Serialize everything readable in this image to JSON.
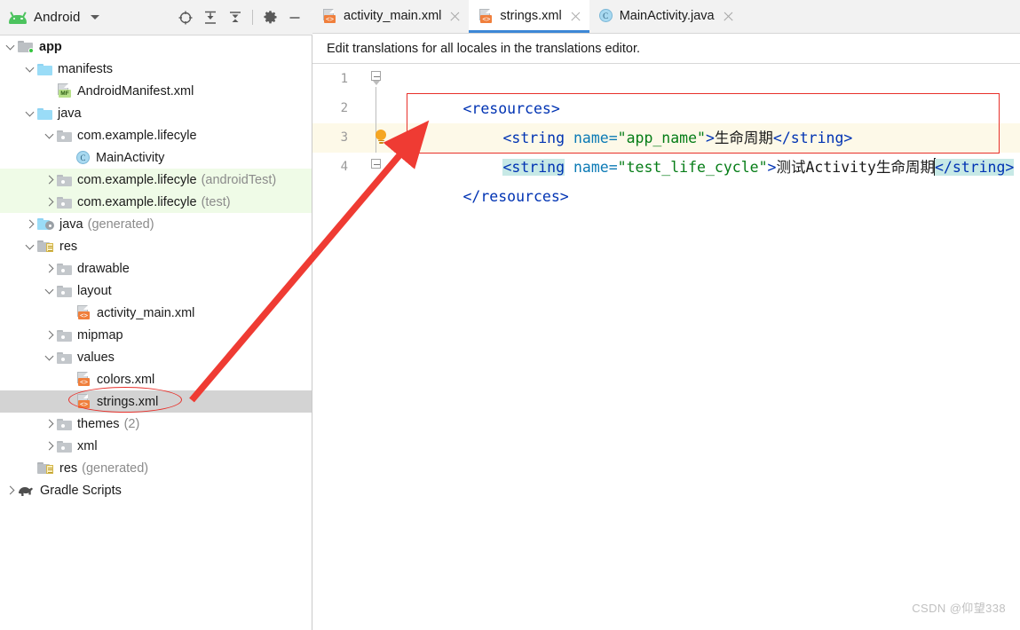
{
  "window": {
    "panel_title": "Android",
    "watermark": "CSDN @仰望338"
  },
  "toolbar": {
    "icons": [
      {
        "name": "locate-target-icon",
        "label": "Select Opened File"
      },
      {
        "name": "expand-all-icon",
        "label": "Expand All"
      },
      {
        "name": "collapse-all-icon",
        "label": "Collapse All"
      },
      {
        "name": "settings-gear-icon",
        "label": "Settings"
      },
      {
        "name": "minimize-icon",
        "label": "Hide"
      }
    ]
  },
  "tree": {
    "items": [
      {
        "label": "app",
        "sub": "",
        "icon": "folder-app-icon",
        "indent": 0,
        "arrow": "expanded",
        "bold": true,
        "state": "normal"
      },
      {
        "label": "manifests",
        "sub": "",
        "icon": "folder-blue-icon",
        "indent": 1,
        "arrow": "expanded",
        "bold": false,
        "state": "normal"
      },
      {
        "label": "AndroidManifest.xml",
        "sub": "",
        "icon": "manifest-file-icon",
        "indent": 2,
        "arrow": "none",
        "bold": false,
        "state": "normal"
      },
      {
        "label": "java",
        "sub": "",
        "icon": "folder-blue-icon",
        "indent": 1,
        "arrow": "expanded",
        "bold": false,
        "state": "normal"
      },
      {
        "label": "com.example.lifecyle",
        "sub": "",
        "icon": "package-icon",
        "indent": 2,
        "arrow": "expanded",
        "bold": false,
        "state": "normal"
      },
      {
        "label": "MainActivity",
        "sub": "",
        "icon": "java-class-icon",
        "indent": 3,
        "arrow": "none",
        "bold": false,
        "state": "normal"
      },
      {
        "label": "com.example.lifecyle",
        "sub": "(androidTest)",
        "icon": "package-icon",
        "indent": 2,
        "arrow": "collapsed",
        "bold": false,
        "state": "green"
      },
      {
        "label": "com.example.lifecyle",
        "sub": "(test)",
        "icon": "package-icon",
        "indent": 2,
        "arrow": "collapsed",
        "bold": false,
        "state": "green"
      },
      {
        "label": "java",
        "sub": "(generated)",
        "icon": "folder-generated-icon",
        "indent": 1,
        "arrow": "collapsed",
        "bold": false,
        "state": "normal"
      },
      {
        "label": "res",
        "sub": "",
        "icon": "folder-res-icon",
        "indent": 1,
        "arrow": "expanded",
        "bold": false,
        "state": "normal"
      },
      {
        "label": "drawable",
        "sub": "",
        "icon": "package-icon",
        "indent": 2,
        "arrow": "collapsed",
        "bold": false,
        "state": "normal"
      },
      {
        "label": "layout",
        "sub": "",
        "icon": "package-icon",
        "indent": 2,
        "arrow": "expanded",
        "bold": false,
        "state": "normal"
      },
      {
        "label": "activity_main.xml",
        "sub": "",
        "icon": "xml-file-icon",
        "indent": 3,
        "arrow": "none",
        "bold": false,
        "state": "normal"
      },
      {
        "label": "mipmap",
        "sub": "",
        "icon": "package-icon",
        "indent": 2,
        "arrow": "collapsed",
        "bold": false,
        "state": "normal"
      },
      {
        "label": "values",
        "sub": "",
        "icon": "package-icon",
        "indent": 2,
        "arrow": "expanded",
        "bold": false,
        "state": "normal"
      },
      {
        "label": "colors.xml",
        "sub": "",
        "icon": "xml-file-icon",
        "indent": 3,
        "arrow": "none",
        "bold": false,
        "state": "normal"
      },
      {
        "label": "strings.xml",
        "sub": "",
        "icon": "xml-file-icon",
        "indent": 3,
        "arrow": "none",
        "bold": false,
        "state": "selected"
      },
      {
        "label": "themes",
        "sub": "(2)",
        "icon": "package-icon",
        "indent": 2,
        "arrow": "collapsed",
        "bold": false,
        "state": "normal"
      },
      {
        "label": "xml",
        "sub": "",
        "icon": "package-icon",
        "indent": 2,
        "arrow": "collapsed",
        "bold": false,
        "state": "normal"
      },
      {
        "label": "res",
        "sub": "(generated)",
        "icon": "folder-res-icon",
        "indent": 1,
        "arrow": "none",
        "bold": false,
        "state": "normal"
      },
      {
        "label": "Gradle Scripts",
        "sub": "",
        "icon": "gradle-icon",
        "indent": 0,
        "arrow": "collapsed",
        "bold": false,
        "state": "normal"
      }
    ]
  },
  "editor": {
    "tabs": [
      {
        "label": "activity_main.xml",
        "icon": "xml-file-icon",
        "active": false
      },
      {
        "label": "strings.xml",
        "icon": "xml-file-icon",
        "active": true
      },
      {
        "label": "MainActivity.java",
        "icon": "java-class-icon",
        "active": false
      }
    ],
    "notification": "Edit translations for all locales in the translations editor.",
    "line_numbers": [
      "1",
      "2",
      "3",
      "4"
    ],
    "current_line": 3,
    "code": {
      "line1": {
        "tag_open": "<resources>"
      },
      "line2": {
        "t1": "<string",
        "t2": " name=",
        "t3": "\"app_name\"",
        "t4": ">",
        "t5": "生命周期",
        "t6": "</string>"
      },
      "line3": {
        "t1": "<string",
        "t2": " name=",
        "t3": "\"test_life_cycle\"",
        "t4": ">",
        "t5": "测试Activity生命周期",
        "t6": "</string>"
      },
      "line4": {
        "tag_close": "</resources>"
      }
    },
    "gutter": {
      "bulb": "intention-lightbulb-icon"
    }
  },
  "annotations": {
    "red_rect": "code-highlight-rectangle",
    "red_ellipse": "strings-xml-highlight-ellipse",
    "red_arrow": "pointer-arrow"
  },
  "colors": {
    "accent_blue": "#3d87d6",
    "annotation_red": "#e8302a",
    "tag": "#0033b3",
    "attr": "#0b7ab5",
    "value": "#067d17",
    "match_highlight": "#c7e9e6",
    "current_line": "#fdf9e8",
    "selection_gray": "#d3d3d3",
    "test_row_green": "#effbe7"
  }
}
